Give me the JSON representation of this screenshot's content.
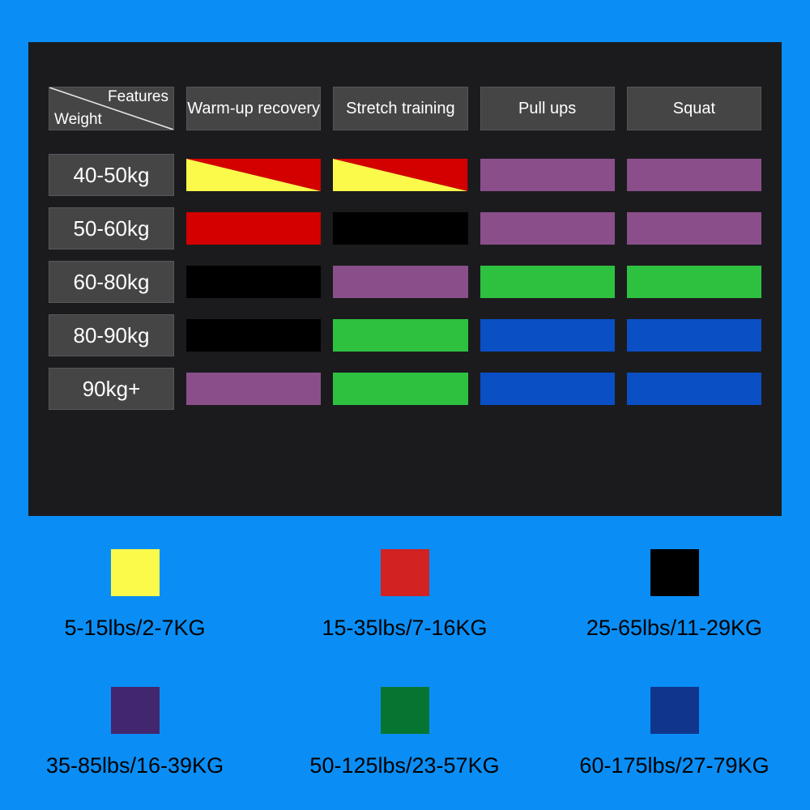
{
  "background_color": "#0a8ef5",
  "panel": {
    "background_color": "#1b1b1e",
    "corner": {
      "features_label": "Features",
      "weight_label": "Weight"
    },
    "columns": [
      {
        "label": "Warm-up recovery"
      },
      {
        "label": "Stretch training"
      },
      {
        "label": "Pull ups"
      },
      {
        "label": "Squat"
      }
    ],
    "rows": [
      {
        "weight_label": "40-50kg",
        "cells": [
          {
            "type": "split",
            "colors": [
              "#fbf94a",
              "#d40000"
            ]
          },
          {
            "type": "split",
            "colors": [
              "#fbf94a",
              "#d40000"
            ]
          },
          {
            "type": "solid",
            "color": "#8a4f8a"
          },
          {
            "type": "solid",
            "color": "#8a4f8a"
          }
        ]
      },
      {
        "weight_label": "50-60kg",
        "cells": [
          {
            "type": "solid",
            "color": "#d40000"
          },
          {
            "type": "solid",
            "color": "#000000"
          },
          {
            "type": "solid",
            "color": "#8a4f8a"
          },
          {
            "type": "solid",
            "color": "#8a4f8a"
          }
        ]
      },
      {
        "weight_label": "60-80kg",
        "cells": [
          {
            "type": "solid",
            "color": "#000000"
          },
          {
            "type": "solid",
            "color": "#8a4f8a"
          },
          {
            "type": "solid",
            "color": "#2ec140"
          },
          {
            "type": "solid",
            "color": "#2ec140"
          }
        ]
      },
      {
        "weight_label": "80-90kg",
        "cells": [
          {
            "type": "solid",
            "color": "#000000"
          },
          {
            "type": "solid",
            "color": "#2ec140"
          },
          {
            "type": "solid",
            "color": "#0a4fc4"
          },
          {
            "type": "solid",
            "color": "#0a4fc4"
          }
        ]
      },
      {
        "weight_label": "90kg+",
        "cells": [
          {
            "type": "solid",
            "color": "#8a4f8a"
          },
          {
            "type": "solid",
            "color": "#2ec140"
          },
          {
            "type": "solid",
            "color": "#0a4fc4"
          },
          {
            "type": "solid",
            "color": "#0a4fc4"
          }
        ]
      }
    ]
  },
  "legend": {
    "items": [
      {
        "color": "#fbf94a",
        "label": "5-15lbs/2-7KG"
      },
      {
        "color": "#d32222",
        "label": "15-35lbs/7-16KG"
      },
      {
        "color": "#000000",
        "label": "25-65lbs/11-29KG"
      },
      {
        "color": "#43276e",
        "label": "35-85lbs/16-39KG"
      },
      {
        "color": "#067531",
        "label": "50-125lbs/23-57KG"
      },
      {
        "color": "#10368c",
        "label": "60-175lbs/27-79KG"
      }
    ]
  }
}
